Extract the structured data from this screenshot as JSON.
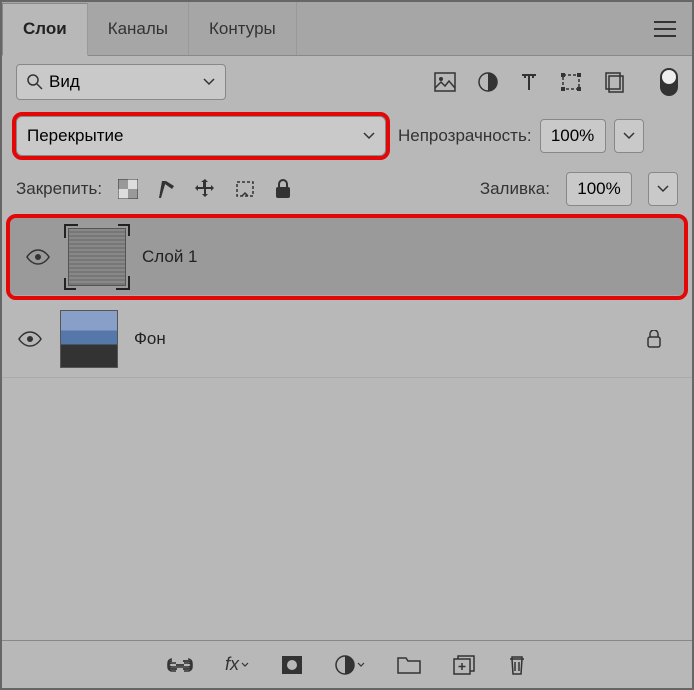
{
  "tabs": {
    "layers": "Слои",
    "channels": "Каналы",
    "paths": "Контуры"
  },
  "search": {
    "label": "Вид"
  },
  "blend": {
    "mode": "Перекрытие"
  },
  "opacity": {
    "label": "Непрозрачность:",
    "value": "100%"
  },
  "lock": {
    "label": "Закрепить:"
  },
  "fill": {
    "label": "Заливка:",
    "value": "100%"
  },
  "layers": [
    {
      "name": "Слой 1",
      "locked": false,
      "selected": true
    },
    {
      "name": "Фон",
      "locked": true,
      "selected": false
    }
  ]
}
